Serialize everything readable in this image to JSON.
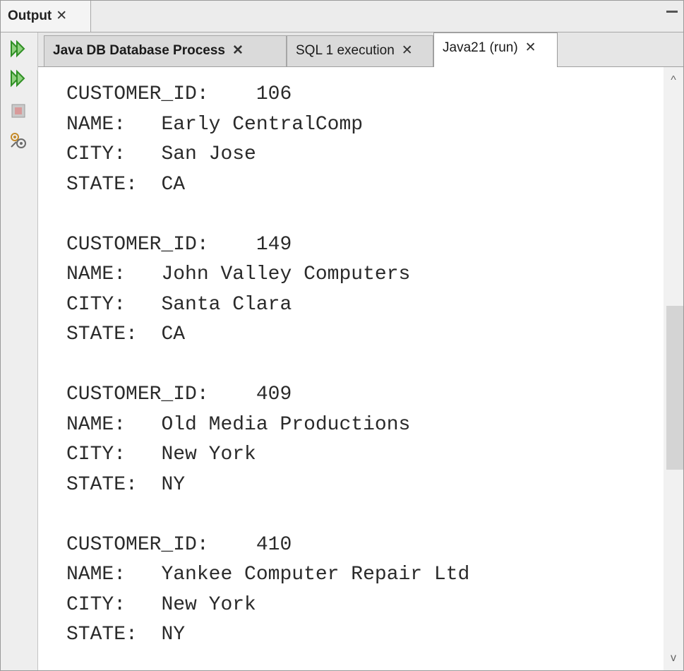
{
  "outer_tab": {
    "label": "Output",
    "close": "✕"
  },
  "toolbar": {
    "icons": [
      "rerun-icon",
      "rerun-with-input-icon",
      "stop-icon",
      "settings-icon"
    ]
  },
  "inner_tabs": [
    {
      "label": "Java DB Database Process",
      "close": "✕"
    },
    {
      "label": "SQL 1 execution",
      "close": "✕"
    },
    {
      "label": "Java21 (run)",
      "close": "✕"
    }
  ],
  "records": [
    {
      "id_label": "CUSTOMER_ID:",
      "id": "106",
      "name_label": "NAME:",
      "name": "Early CentralComp",
      "city_label": "CITY:",
      "city": "San Jose",
      "state_label": "STATE:",
      "state": "CA"
    },
    {
      "id_label": "CUSTOMER_ID:",
      "id": "149",
      "name_label": "NAME:",
      "name": "John Valley Computers",
      "city_label": "CITY:",
      "city": "Santa Clara",
      "state_label": "STATE:",
      "state": "CA"
    },
    {
      "id_label": "CUSTOMER_ID:",
      "id": "409",
      "name_label": "NAME:",
      "name": "Old Media Productions",
      "city_label": "CITY:",
      "city": "New York",
      "state_label": "STATE:",
      "state": "NY"
    },
    {
      "id_label": "CUSTOMER_ID:",
      "id": "410",
      "name_label": "NAME:",
      "name": "Yankee Computer Repair Ltd",
      "city_label": "CITY:",
      "city": "New York",
      "state_label": "STATE:",
      "state": "NY"
    }
  ],
  "colors": {
    "rerun_green": "#3fa832",
    "stop_gray": "#b8b8b8"
  }
}
